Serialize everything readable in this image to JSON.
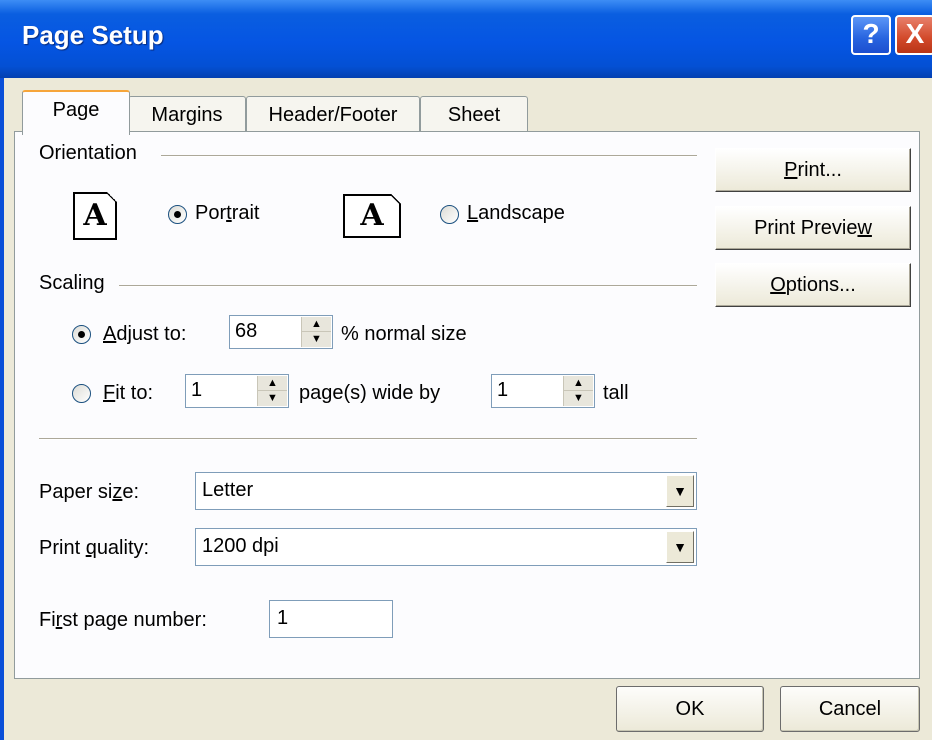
{
  "window": {
    "title": "Page Setup"
  },
  "titlebar": {
    "help_label": "?",
    "close_label": "X"
  },
  "tabs": [
    {
      "label": "Page"
    },
    {
      "label": "Margins"
    },
    {
      "label": "Header/Footer"
    },
    {
      "label": "Sheet"
    }
  ],
  "orientation": {
    "heading": "Orientation",
    "portrait_glyph": "A",
    "landscape_glyph": "A",
    "portrait_pre": "Por",
    "portrait_u": "t",
    "portrait_post": "rait",
    "landscape_u": "L",
    "landscape_post": "andscape",
    "selected": "portrait"
  },
  "scaling": {
    "heading": "Scaling",
    "adjust_u": "A",
    "adjust_post": "djust to:",
    "adjust_value": "68",
    "adjust_suffix": "% normal size",
    "fit_u": "F",
    "fit_post": "it to:",
    "fit_wide_value": "1",
    "fit_wide_suffix": "page(s) wide by",
    "fit_tall_value": "1",
    "fit_tall_suffix": "tall",
    "selected": "adjust"
  },
  "paper_size": {
    "label_pre": "Paper si",
    "label_u": "z",
    "label_post": "e:",
    "value": "Letter"
  },
  "print_quality": {
    "label_pre": "Print ",
    "label_u": "q",
    "label_post": "uality:",
    "value": "1200 dpi"
  },
  "first_page": {
    "label_pre": "Fi",
    "label_u": "r",
    "label_post": "st page number:",
    "value": "1"
  },
  "side_buttons": {
    "print_u": "P",
    "print_post": "rint...",
    "preview_pre": "Print Previe",
    "preview_u": "w",
    "options_u": "O",
    "options_post": "ptions..."
  },
  "footer": {
    "ok_label": "OK",
    "cancel_label": "Cancel"
  },
  "icons": {
    "spin_up": "▲",
    "spin_down": "▼",
    "dropdown": "▼"
  }
}
